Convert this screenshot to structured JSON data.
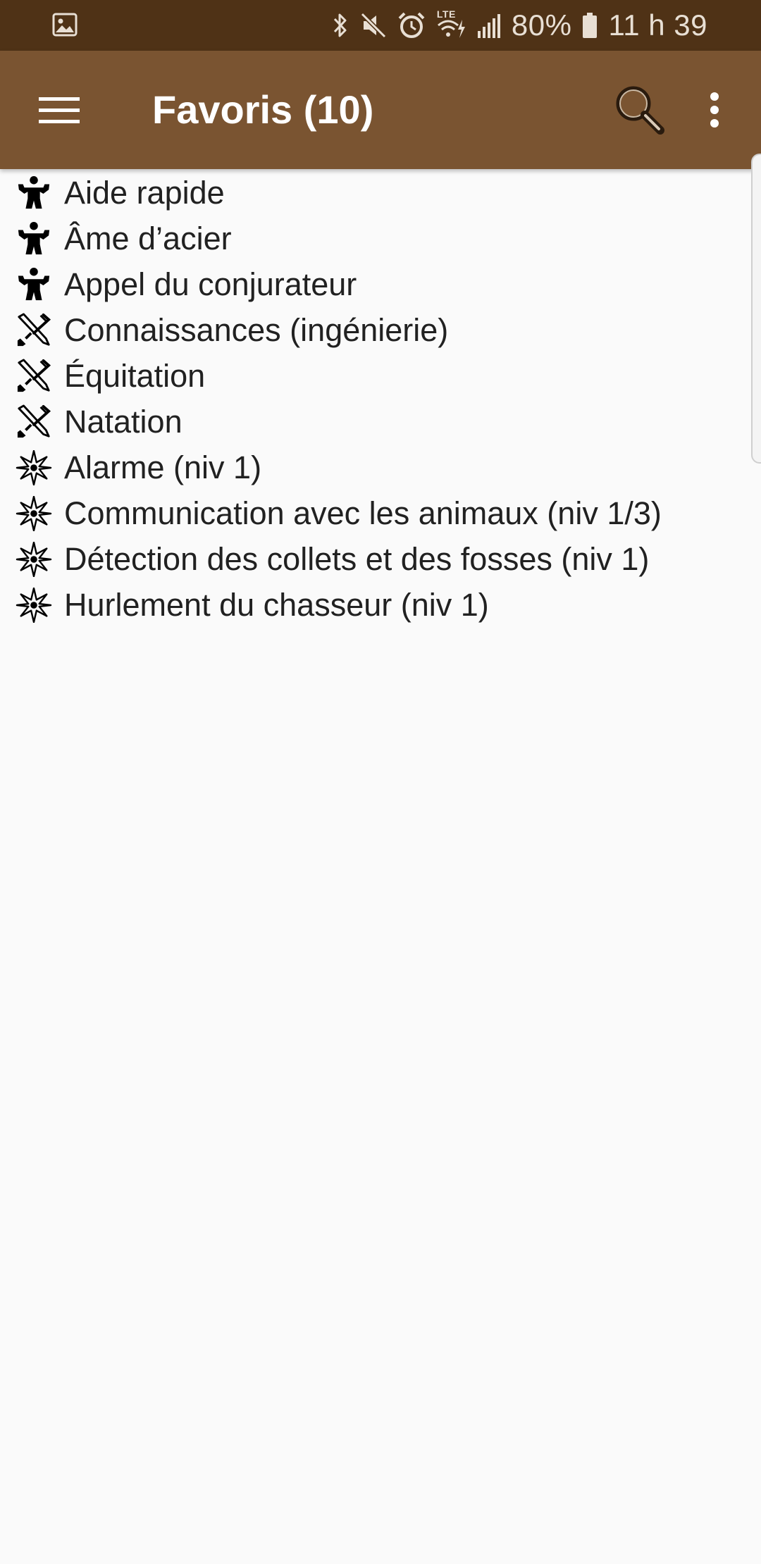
{
  "status_bar": {
    "network_label": "LTE",
    "battery": "80%",
    "time": "11 h 39"
  },
  "app_bar": {
    "title": "Favoris (10)",
    "menu_icon": "hamburger-menu-icon",
    "search_icon": "search-icon",
    "overflow_icon": "more-vert-icon"
  },
  "colors": {
    "status_bar_bg": "#4f3216",
    "app_bar_bg": "#7a5431",
    "page_bg": "#fafafa",
    "text": "#212121"
  },
  "favorites": [
    {
      "icon": "strength-figure-icon",
      "label": "Aide rapide"
    },
    {
      "icon": "strength-figure-icon",
      "label": "Âme d’acier"
    },
    {
      "icon": "strength-figure-icon",
      "label": "Appel du conjurateur"
    },
    {
      "icon": "tools-crossed-icon",
      "label": "Connaissances (ingénierie)"
    },
    {
      "icon": "tools-crossed-icon",
      "label": "Équitation"
    },
    {
      "icon": "tools-crossed-icon",
      "label": "Natation"
    },
    {
      "icon": "magic-star-icon",
      "label": "Alarme (niv 1)"
    },
    {
      "icon": "magic-star-icon",
      "label": "Communication avec les animaux (niv 1/3)"
    },
    {
      "icon": "magic-star-icon",
      "label": "Détection des collets et des fosses (niv 1)"
    },
    {
      "icon": "magic-star-icon",
      "label": "Hurlement du chasseur (niv 1)"
    }
  ]
}
